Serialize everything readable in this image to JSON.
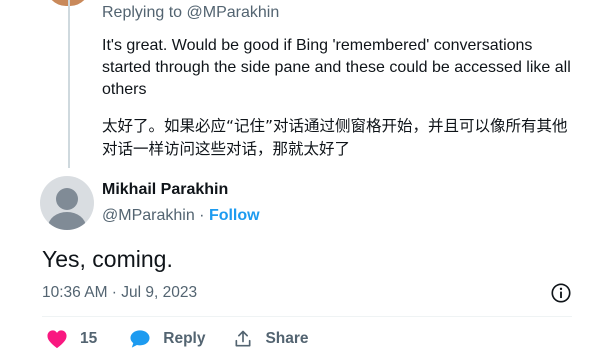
{
  "reply_context": {
    "replying_prefix": "Replying to",
    "replying_handle": "@MParakhin",
    "text_en": "It's great. Would be good if Bing 'remembered' conversations started through the side pane and these could be accessed like all others",
    "text_cn": "太好了。如果必应“记住”对话通过侧窗格开始，并且可以像所有其他对话一样访问这些对话，那就太好了"
  },
  "author": {
    "name": "Mikhail Parakhin",
    "handle": "@MParakhin",
    "separator": " · ",
    "follow_label": "Follow"
  },
  "tweet": {
    "text": "Yes, coming.",
    "time": "10:36 AM",
    "date_separator": " · ",
    "date": "Jul 9, 2023"
  },
  "actions": {
    "like_count": "15",
    "reply_label": "Reply",
    "share_label": "Share"
  },
  "colors": {
    "accent": "#1d9bf0",
    "like": "#f91880",
    "secondary_text": "#536471",
    "thread_line": "#cfd9de"
  }
}
